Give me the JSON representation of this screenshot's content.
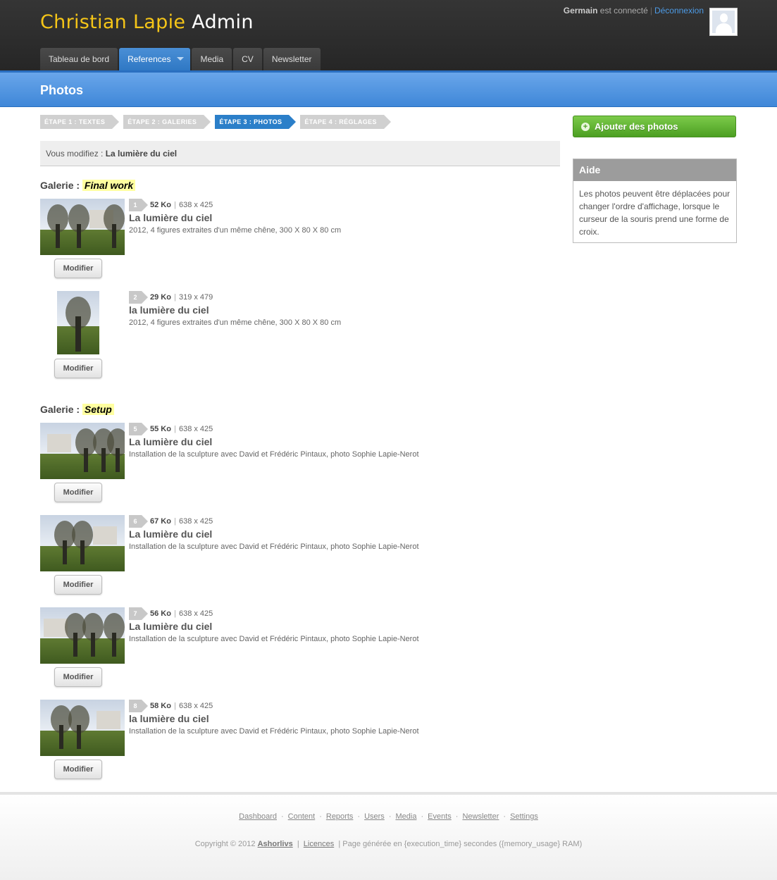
{
  "header": {
    "brand_name": "Christian Lapie",
    "brand_suffix": "Admin",
    "user_name": "Germain",
    "user_status": "est connecté",
    "logout": "Déconnexion",
    "nav": [
      {
        "label": "Tableau de bord",
        "active": false
      },
      {
        "label": "References",
        "active": true
      },
      {
        "label": "Media",
        "active": false
      },
      {
        "label": "CV",
        "active": false
      },
      {
        "label": "Newsletter",
        "active": false
      }
    ]
  },
  "page": {
    "title": "Photos",
    "steps": [
      {
        "label": "ÉTAPE 1 : TEXTES",
        "active": false
      },
      {
        "label": "ÉTAPE 2 : GALERIES",
        "active": false
      },
      {
        "label": "ÉTAPE 3 : PHOTOS",
        "active": true
      },
      {
        "label": "ÉTAPE 4 : RÉGLAGES",
        "active": false
      }
    ],
    "editing_prefix": "Vous modifiez :",
    "editing_value": "La lumière du ciel"
  },
  "galleries": [
    {
      "label": "Galerie :",
      "name": "Final work",
      "photos": [
        {
          "num": "1",
          "size": "52 Ko",
          "dims": "638 x 425",
          "title": "La lumière du ciel",
          "desc": "2012, 4 figures extraites d'un même chêne, 300 X 80 X 80 cm",
          "button": "Modifier"
        },
        {
          "num": "2",
          "size": "29 Ko",
          "dims": "319 x 479",
          "title": "la lumière du ciel",
          "desc": "2012, 4 figures extraites d'un même chêne, 300 X 80 X 80 cm",
          "button": "Modifier"
        }
      ]
    },
    {
      "label": "Galerie :",
      "name": "Setup",
      "photos": [
        {
          "num": "5",
          "size": "55 Ko",
          "dims": "638 x 425",
          "title": "La lumière du ciel",
          "desc": "Installation de la sculpture avec David et Frédéric Pintaux, photo Sophie Lapie-Nerot",
          "button": "Modifier"
        },
        {
          "num": "6",
          "size": "67 Ko",
          "dims": "638 x 425",
          "title": "La lumière du ciel",
          "desc": "Installation de la sculpture avec David et Frédéric Pintaux, photo Sophie Lapie-Nerot",
          "button": "Modifier"
        },
        {
          "num": "7",
          "size": "56 Ko",
          "dims": "638 x 425",
          "title": "La lumière du ciel",
          "desc": "Installation de la sculpture avec David et Frédéric Pintaux, photo Sophie Lapie-Nerot",
          "button": "Modifier"
        },
        {
          "num": "8",
          "size": "58 Ko",
          "dims": "638 x 425",
          "title": "la lumière du ciel",
          "desc": "Installation de la sculpture avec David et Frédéric Pintaux, photo Sophie Lapie-Nerot",
          "button": "Modifier"
        }
      ]
    }
  ],
  "sidebar": {
    "add_button": "Ajouter des photos",
    "help_title": "Aide",
    "help_text": "Les photos peuvent être déplacées pour changer l'ordre d'affichage, lorsque le curseur de la souris prend une forme de croix."
  },
  "footer": {
    "links": [
      "Dashboard",
      "Content",
      "Reports",
      "Users",
      "Media",
      "Events",
      "Newsletter",
      "Settings"
    ],
    "copyright": "Copyright © 2012",
    "brand": "Ashorlivs",
    "licences": "Licences",
    "generated": "Page générée en {execution_time} secondes ({memory_usage} RAM)"
  }
}
